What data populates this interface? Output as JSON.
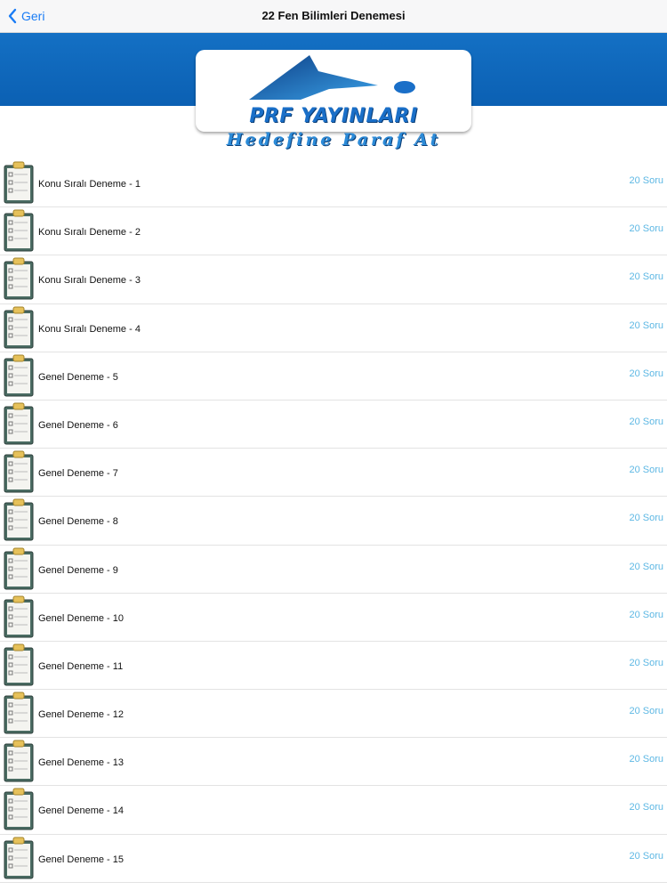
{
  "navbar": {
    "back_label": "Geri",
    "title": "22 Fen Bilimleri Denemesi"
  },
  "banner": {
    "logo_text": "PRF YAYINLARI",
    "slogan": "Hedefine Paraf At",
    "brand_color": "#0b60b3"
  },
  "list": {
    "items": [
      {
        "title": "Konu Sıralı Deneme - 1",
        "count": "20 Soru"
      },
      {
        "title": "Konu Sıralı Deneme - 2",
        "count": "20 Soru"
      },
      {
        "title": "Konu Sıralı Deneme - 3",
        "count": "20 Soru"
      },
      {
        "title": "Konu Sıralı Deneme - 4",
        "count": "20 Soru"
      },
      {
        "title": "Genel Deneme - 5",
        "count": "20 Soru"
      },
      {
        "title": "Genel Deneme - 6",
        "count": "20 Soru"
      },
      {
        "title": "Genel Deneme - 7",
        "count": "20 Soru"
      },
      {
        "title": "Genel Deneme - 8",
        "count": "20 Soru"
      },
      {
        "title": "Genel Deneme - 9",
        "count": "20 Soru"
      },
      {
        "title": "Genel Deneme - 10",
        "count": "20 Soru"
      },
      {
        "title": "Genel Deneme - 11",
        "count": "20 Soru"
      },
      {
        "title": "Genel Deneme - 12",
        "count": "20 Soru"
      },
      {
        "title": "Genel Deneme - 13",
        "count": "20 Soru"
      },
      {
        "title": "Genel Deneme - 14",
        "count": "20 Soru"
      },
      {
        "title": "Genel Deneme - 15",
        "count": "20 Soru"
      }
    ]
  },
  "icons": {
    "back": "chevron-left-icon",
    "row": "clipboard-checklist-icon"
  }
}
